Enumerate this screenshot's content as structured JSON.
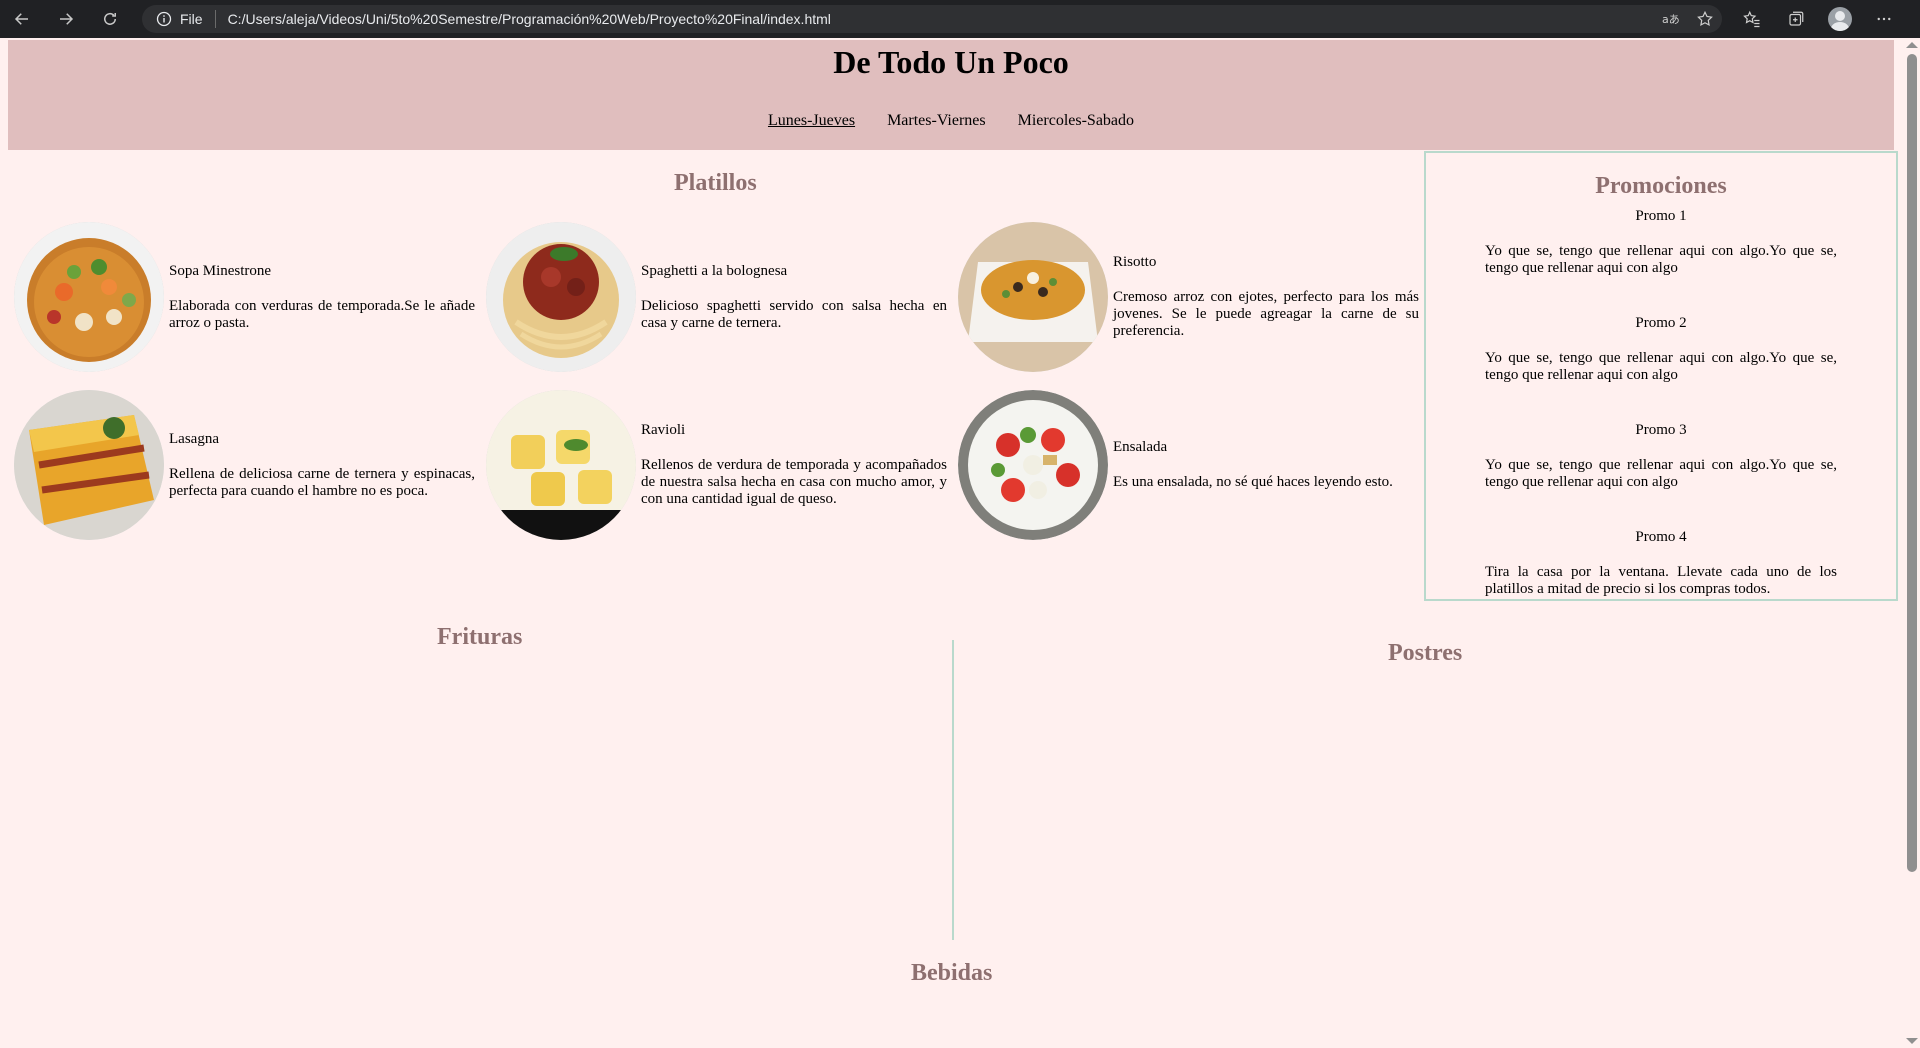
{
  "browser": {
    "file_label": "File",
    "url": "C:/Users/aleja/Videos/Uni/5to%20Semestre/Programación%20Web/Proyecto%20Final/index.html"
  },
  "header": {
    "title": "De Todo Un Poco",
    "nav": [
      "Lunes-Jueves",
      "Martes-Viernes",
      "Miercoles-Sabado"
    ]
  },
  "platillos": {
    "title": "Platillos",
    "dishes": [
      {
        "name": "Sopa Minestrone",
        "desc": "Elaborada con verduras de temporada.Se le añade arroz o pasta."
      },
      {
        "name": "Spaghetti a la bolognesa",
        "desc": "Delicioso spaghetti servido con salsa hecha en casa y carne de ternera."
      },
      {
        "name": "Risotto",
        "desc": "Cremoso arroz con ejotes, perfecto para los más jovenes. Se le puede agreagar la carne de su preferencia."
      },
      {
        "name": "Lasagna",
        "desc": "Rellena de deliciosa carne de ternera y espinacas, perfecta para cuando el hambre no es poca."
      },
      {
        "name": "Ravioli",
        "desc": "Rellenos de verdura de temporada y acompañados de nuestra salsa hecha en casa con mucho amor, y con una cantidad igual de queso."
      },
      {
        "name": "Ensalada",
        "desc": "Es una ensalada, no sé qué haces leyendo esto."
      }
    ]
  },
  "promociones": {
    "title": "Promociones",
    "items": [
      {
        "title": "Promo 1",
        "desc": "Yo que se, tengo que rellenar aqui con algo.Yo que se, tengo que rellenar aqui con algo"
      },
      {
        "title": "Promo 2",
        "desc": "Yo que se, tengo que rellenar aqui con algo.Yo que se, tengo que rellenar aqui con algo"
      },
      {
        "title": "Promo 3",
        "desc": "Yo que se, tengo que rellenar aqui con algo.Yo que se, tengo que rellenar aqui con algo"
      },
      {
        "title": "Promo 4",
        "desc": "Tira la casa por la ventana. Llevate cada uno de los platillos a mitad de precio si los compras todos."
      }
    ]
  },
  "sections": {
    "frituras": "Frituras",
    "postres": "Postres",
    "bebidas": "Bebidas"
  },
  "colors": {
    "page_bg": "#fff0ef",
    "header_bg": "#e0bebe",
    "section_title": "#8e7070",
    "accent_border": "#b9d9cc"
  }
}
